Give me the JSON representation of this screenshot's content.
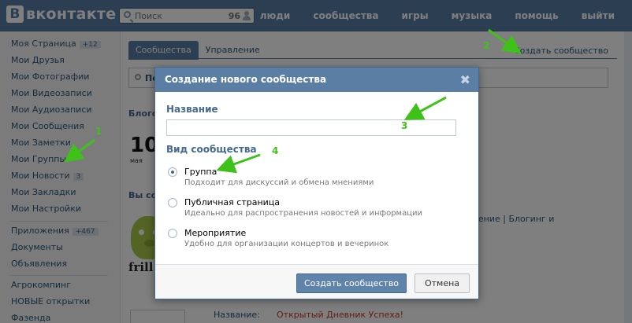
{
  "header": {
    "logo": "вконтакте",
    "logo_mark": "В",
    "search_placeholder": "Поиск",
    "search_count": "96",
    "nav": [
      "люди",
      "сообщества",
      "игры",
      "музыка",
      "помощь",
      "выйти"
    ]
  },
  "sidebar": {
    "items": [
      {
        "label": "Моя Страница",
        "badge": "+12"
      },
      {
        "label": "Мои Друзья"
      },
      {
        "label": "Мои Фотографии"
      },
      {
        "label": "Мои Видеозаписи"
      },
      {
        "label": "Мои Аудиозаписи"
      },
      {
        "label": "Мои Сообщения"
      },
      {
        "label": "Мои Заметки"
      },
      {
        "label": "Мои Группы"
      },
      {
        "label": "Мои Новости",
        "badge": "3"
      },
      {
        "label": "Мои Закладки"
      },
      {
        "label": "Мои Настройки"
      },
      {
        "label": "Приложения",
        "badge": "+467"
      },
      {
        "label": "Документы"
      },
      {
        "label": "Объявления"
      },
      {
        "label": "Агрокомпинг"
      },
      {
        "label": "НОВЫЕ открытки"
      },
      {
        "label": "Фазенда"
      }
    ]
  },
  "main": {
    "tabs": [
      "Сообщества",
      "Управление"
    ],
    "create_link": "Создать сообщество",
    "search_text": "Пе",
    "section_blog": "Блого",
    "section_yours": "Вы со",
    "news_number": "10",
    "news_day": "мая",
    "pig_brand": "frill",
    "bg_links_1": "жение | Блогинг и",
    "bg_label_name": "Название:",
    "bg_value_name": "Открытый Дневник Успеха!"
  },
  "modal": {
    "title": "Создание нового сообщества",
    "close": "✖",
    "name_label": "Название",
    "name_value": "",
    "type_label": "Вид сообщества",
    "options": [
      {
        "title": "Группа",
        "desc": "Подходит для дискуссий и обмена мнениями",
        "checked": true
      },
      {
        "title": "Публичная страница",
        "desc": "Идеально для распространения новостей и информации",
        "checked": false
      },
      {
        "title": "Мероприятие",
        "desc": "Удобно для организации концертов и вечеринок",
        "checked": false
      }
    ],
    "submit": "Создать сообщество",
    "cancel": "Отмена"
  },
  "annotations": {
    "color": "#3ec21a",
    "numbers": [
      "1",
      "2",
      "3",
      "4"
    ]
  }
}
